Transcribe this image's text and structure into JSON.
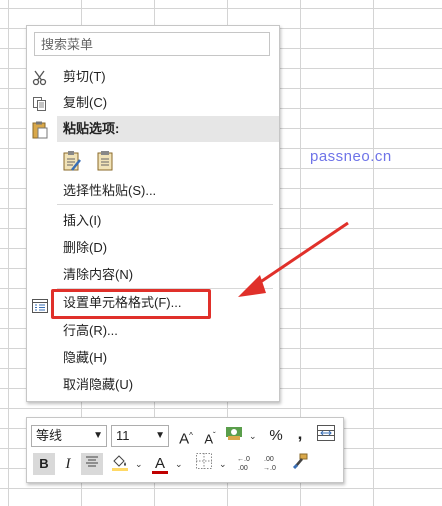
{
  "menu": {
    "search_placeholder": "搜索菜单",
    "cut": "剪切(T)",
    "copy": "复制(C)",
    "paste_options": "粘贴选项:",
    "paste_special": "选择性粘贴(S)...",
    "insert": "插入(I)",
    "delete": "删除(D)",
    "clear_contents": "清除内容(N)",
    "format_cells": "设置单元格格式(F)...",
    "row_height": "行高(R)...",
    "hide": "隐藏(H)",
    "unhide": "取消隐藏(U)"
  },
  "watermark": "passneo.cn",
  "toolbar": {
    "font_name": "等线",
    "font_size": "11",
    "grow_font": "A",
    "shrink_font": "A",
    "percent": "%",
    "comma": ",",
    "bold": "B",
    "italic": "I",
    "font_color": "A",
    "inc_decimal": "+.0 .00",
    "dec_decimal": ".00 →.0"
  },
  "colors": {
    "highlight_border": "#e0302a",
    "arrow": "#e0302a",
    "watermark": "#6f74e8",
    "header_bg": "#e6e6e6"
  },
  "icons": [
    "scissors-icon",
    "copy-icon",
    "clipboard-icon",
    "paste-format-icon",
    "paste-icon",
    "format-cells-icon",
    "accounting-format-icon",
    "merge-icon",
    "fill-color-icon",
    "borders-icon",
    "format-painter-icon"
  ]
}
